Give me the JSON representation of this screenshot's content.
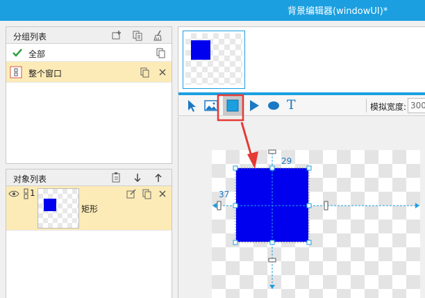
{
  "window": {
    "title": "背景编辑器(windowUI)*"
  },
  "groups": {
    "title": "分组列表",
    "items": [
      {
        "label": "全部"
      },
      {
        "label": "整个窗口"
      }
    ]
  },
  "objects": {
    "title": "对象列表",
    "items": [
      {
        "index": "1",
        "label": "矩形"
      }
    ]
  },
  "toolbar": {
    "tools": [
      "pointer-tool",
      "image-tool",
      "rect-tool",
      "triangle-tool",
      "ellipse-tool",
      "text-tool"
    ],
    "text_glyph": "T",
    "sim_width_label": "模拟宽度:",
    "sim_width_value": "300"
  },
  "canvas": {
    "offset_y": "29",
    "offset_x": "37"
  },
  "colors": {
    "accent": "#1b9fe0",
    "rect_fill": "#0000ee",
    "selected_row": "#fcebb6",
    "highlight": "#e53935"
  },
  "thumbnail": {
    "progress": 1.0
  }
}
